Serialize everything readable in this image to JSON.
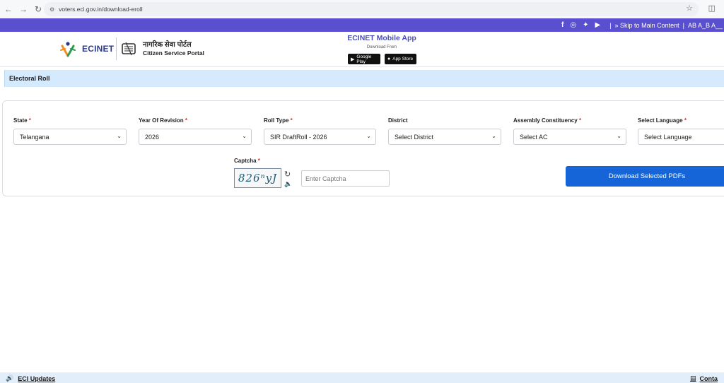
{
  "browser": {
    "url": "voters.eci.gov.in/download-eroll"
  },
  "topbar": {
    "social_icons": [
      "facebook-icon",
      "instagram-icon",
      "twitter-icon",
      "youtube-icon"
    ],
    "separator": "|",
    "skip_link": "» Skip to Main Content",
    "font_sizes": "AB A_B A__"
  },
  "header": {
    "logo_text": "ECINET",
    "portal_hindi": "नागरिक सेवा पोर्टल",
    "portal_en": "Citizen Service Portal",
    "app_title": "ECINET Mobile App",
    "app_subtitle": "Download From",
    "google_play": "Google Play",
    "app_store": "App Store"
  },
  "page": {
    "section_title": "Electoral Roll"
  },
  "form": {
    "required_mark": "*",
    "fields": [
      {
        "label": "State",
        "value": "Telangana"
      },
      {
        "label": "Year Of Revision",
        "value": "2026"
      },
      {
        "label": "Roll Type",
        "value": "SIR DraftRoll - 2026"
      },
      {
        "label": "District",
        "value": "Select District"
      },
      {
        "label": "Assembly Constituency",
        "value": "Select AC"
      },
      {
        "label": "Select Language",
        "value": "Select Language"
      }
    ],
    "captcha_label": "Captcha",
    "captcha_text": "826ⁿyJ",
    "captcha_placeholder": "Enter Captcha",
    "download_button": "Download Selected PDFs"
  },
  "footer": {
    "updates": "ECI Updates",
    "contact": "Conta"
  }
}
